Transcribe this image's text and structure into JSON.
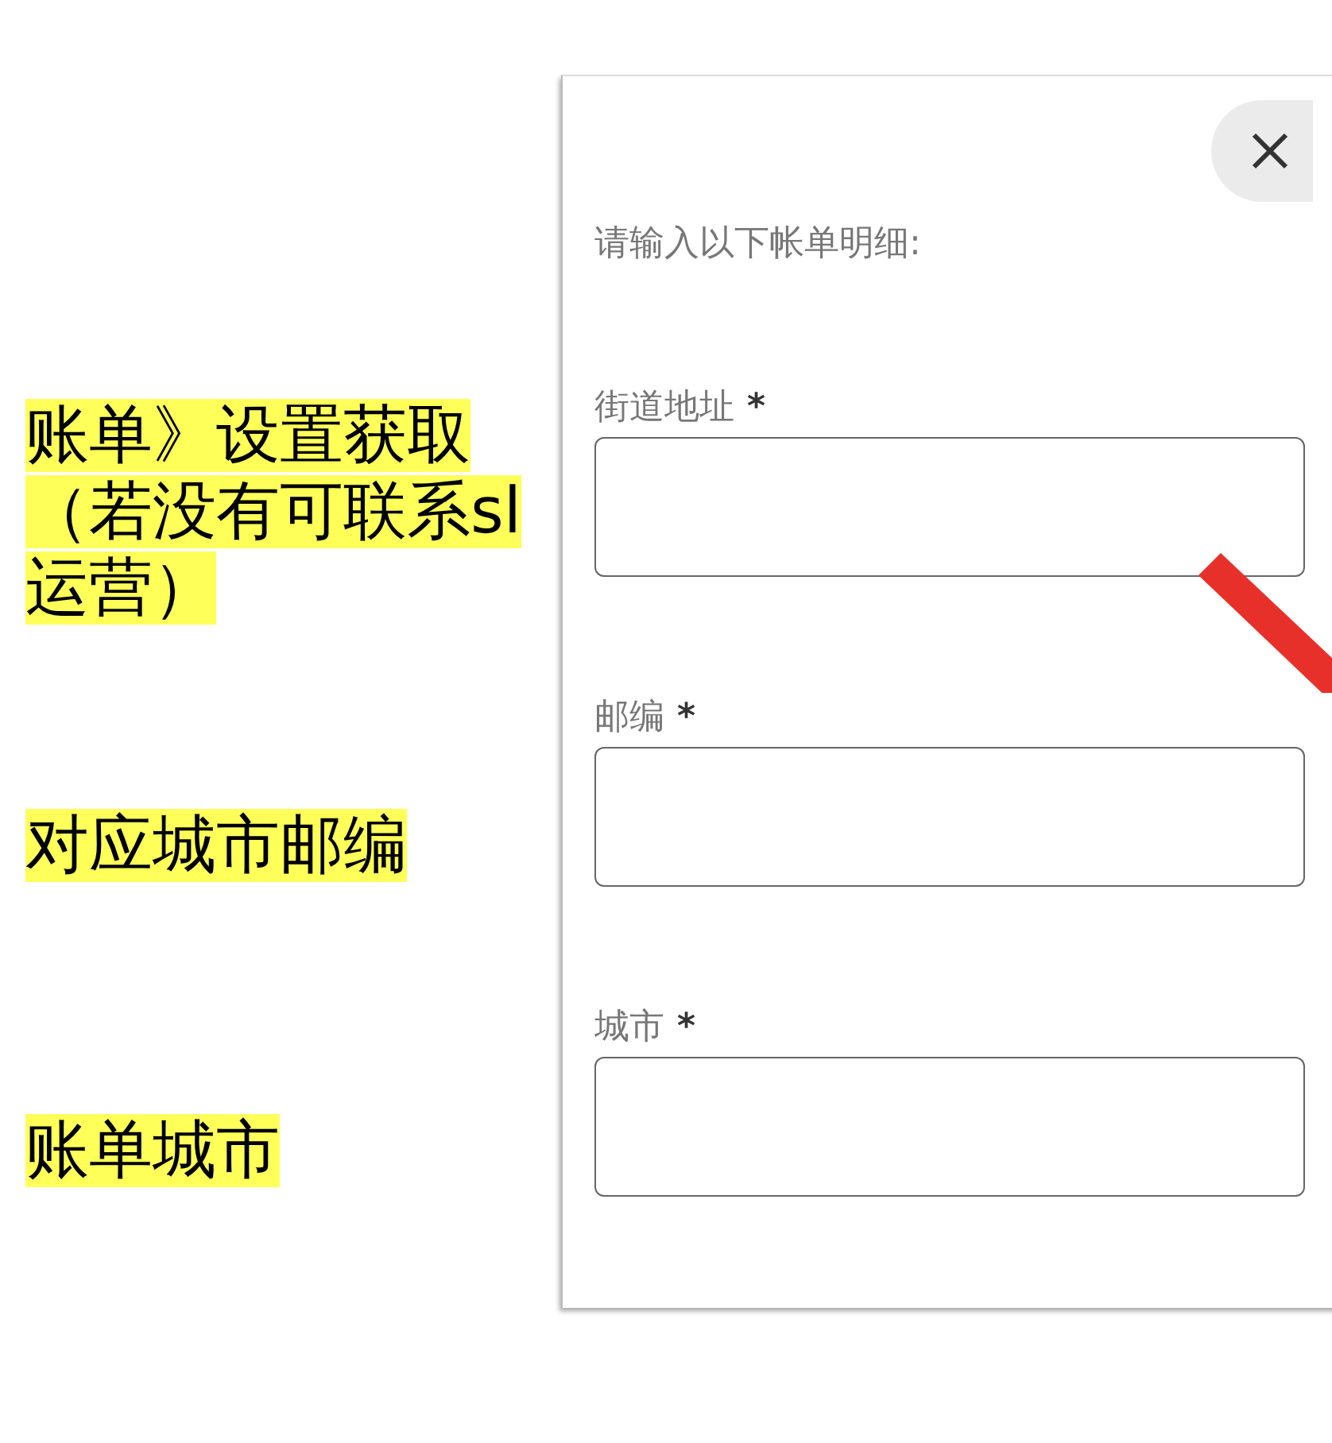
{
  "notes": [
    {
      "text": "账单》设置获取（若没有可联系sl运营）"
    },
    {
      "text": "对应城市邮编"
    },
    {
      "text": "账单城市"
    }
  ],
  "dialog": {
    "intro": "请输入以下帐单明细:",
    "fields": [
      {
        "label": "街道地址",
        "required_mark": "*"
      },
      {
        "label": "邮编",
        "required_mark": "*"
      },
      {
        "label": "城市",
        "required_mark": "*"
      }
    ]
  }
}
